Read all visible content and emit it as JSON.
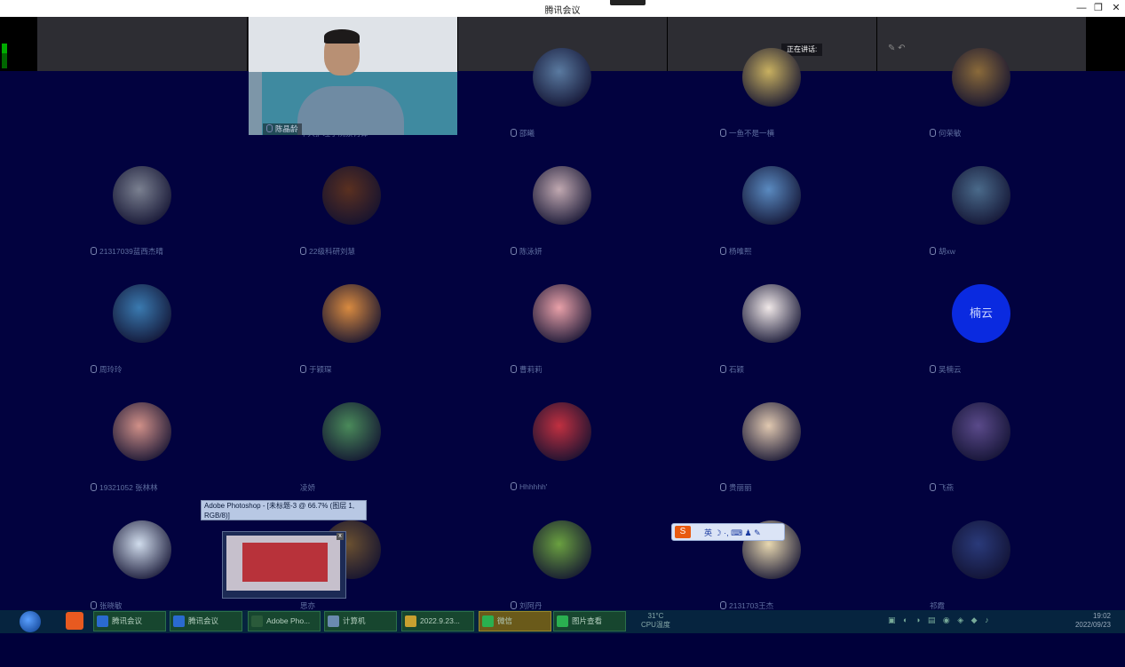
{
  "window": {
    "title": "腾讯会议",
    "minimize": "—",
    "restore": "❐",
    "close": "✕"
  },
  "speaking_label": "正在讲话:",
  "video": {
    "name": "陈晶龄"
  },
  "participants": [
    {
      "name": "中大护理学院紫荷锋",
      "mic": false,
      "color": "#d84a3a"
    },
    {
      "name": "邵曦",
      "mic": true,
      "color": "#5a7aa0"
    },
    {
      "name": "一鱼不是一横",
      "mic": true,
      "color": "#c8b060"
    },
    {
      "name": "何荣敏",
      "mic": true,
      "color": "#8a6a3a"
    },
    {
      "name": "21317039蓝西杰晴",
      "mic": true,
      "color": "#7a8090"
    },
    {
      "name": "22级科研刘慧",
      "mic": true,
      "color": "#5a3020"
    },
    {
      "name": "陈泳妍",
      "mic": true,
      "color": "#c0a8b0"
    },
    {
      "name": "杨唯熙",
      "mic": true,
      "color": "#5a8ac0"
    },
    {
      "name": "胡xw",
      "mic": true,
      "color": "#4a6a8a"
    },
    {
      "name": "周玲玲",
      "mic": true,
      "color": "#3a7ab0"
    },
    {
      "name": "于颖琛",
      "mic": true,
      "color": "#d88a40"
    },
    {
      "name": "曹莉莉",
      "mic": true,
      "color": "#e8a0a8"
    },
    {
      "name": "石颖",
      "mic": true,
      "color": "#f0e8e8"
    },
    {
      "name": "吴楠云",
      "mic": true,
      "text": "楠云"
    },
    {
      "name": "19321052 张林林",
      "mic": true,
      "color": "#d09088"
    },
    {
      "name": "凌娇",
      "mic": false,
      "color": "#4a8a5a"
    },
    {
      "name": "Hhhhhh'",
      "mic": true,
      "color": "#c03040"
    },
    {
      "name": "贵丽丽",
      "mic": true,
      "color": "#e0c8b0"
    },
    {
      "name": "飞燕",
      "mic": true,
      "color": "#5a4a8a"
    },
    {
      "name": "张晓敏",
      "mic": true,
      "color": "#d0dcec"
    },
    {
      "name": "思亦",
      "mic": false,
      "color": "#6a5030"
    },
    {
      "name": "刘阿丹",
      "mic": true,
      "color": "#6aa040"
    },
    {
      "name": "2131703王杰",
      "mic": true,
      "color": "#e8d8b0"
    },
    {
      "name": "祁霞",
      "mic": false,
      "color": "#2a3a7a"
    }
  ],
  "photoshop_tip": "Adobe Photoshop - [未标题-3 @ 66.7% (图层 1, RGB/8)]",
  "ime": {
    "logo": "S",
    "text": "英 ☽ ·, ⌨ ♟ ✎"
  },
  "taskbar": {
    "items": [
      {
        "label": "腾讯会议",
        "color": "#2a6ad0"
      },
      {
        "label": "腾讯会议",
        "color": "#2a6ad0"
      },
      {
        "label": "Adobe Pho...",
        "color": "#2a5a3a"
      },
      {
        "label": "计算机",
        "color": "#6a8ab0"
      },
      {
        "label": "2022.9.23...",
        "color": "#c8a030"
      },
      {
        "label": "微信",
        "color": "#2ab050"
      },
      {
        "label": "图片查看",
        "color": "#2ab050"
      }
    ],
    "temp": "31°C",
    "temp_label": "CPU温度",
    "time": "19:02",
    "date": "2022/09/23"
  }
}
